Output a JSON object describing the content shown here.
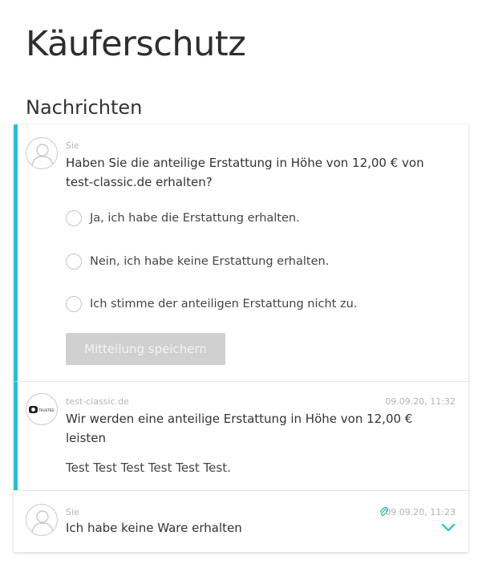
{
  "page": {
    "title": "Käuferschutz",
    "section_title": "Nachrichten"
  },
  "colors": {
    "accent": "#20c4cf",
    "button_disabled": "#d0d0d0"
  },
  "messages": [
    {
      "sender": "Sie",
      "question": "Haben Sie die anteilige Erstattung in Höhe von 12,00 € von test-classic.de erhalten?",
      "options": [
        "Ja, ich habe die Erstattung erhalten.",
        "Nein, ich habe keine Erstattung erhalten.",
        "Ich stimme der anteiligen Erstattung nicht zu."
      ],
      "save_label": "Mitteilung speichern"
    },
    {
      "sender": "test-classic.de",
      "timestamp": "09.09.20, 11:32",
      "headline": "Wir werden eine anteilige Erstattung in Höhe von 12,00 € leisten",
      "text": "Test Test Test Test Test Test.",
      "avatar_logo": "TRUSTED"
    },
    {
      "sender": "Sie",
      "timestamp": "09.09.20, 11:23",
      "text": "Ich habe keine Ware erhalten",
      "attachment_icon": "paperclip-icon",
      "expand_icon": "chevron-down-icon"
    }
  ]
}
